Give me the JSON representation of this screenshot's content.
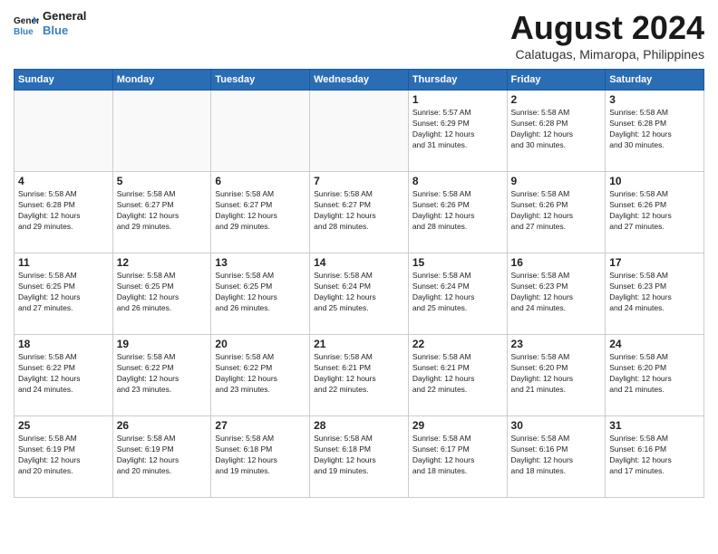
{
  "logo": {
    "line1": "General",
    "line2": "Blue"
  },
  "title": "August 2024",
  "location": "Calatugas, Mimaropa, Philippines",
  "days_of_week": [
    "Sunday",
    "Monday",
    "Tuesday",
    "Wednesday",
    "Thursday",
    "Friday",
    "Saturday"
  ],
  "weeks": [
    [
      {
        "day": "",
        "info": ""
      },
      {
        "day": "",
        "info": ""
      },
      {
        "day": "",
        "info": ""
      },
      {
        "day": "",
        "info": ""
      },
      {
        "day": "1",
        "info": "Sunrise: 5:57 AM\nSunset: 6:29 PM\nDaylight: 12 hours\nand 31 minutes."
      },
      {
        "day": "2",
        "info": "Sunrise: 5:58 AM\nSunset: 6:28 PM\nDaylight: 12 hours\nand 30 minutes."
      },
      {
        "day": "3",
        "info": "Sunrise: 5:58 AM\nSunset: 6:28 PM\nDaylight: 12 hours\nand 30 minutes."
      }
    ],
    [
      {
        "day": "4",
        "info": "Sunrise: 5:58 AM\nSunset: 6:28 PM\nDaylight: 12 hours\nand 29 minutes."
      },
      {
        "day": "5",
        "info": "Sunrise: 5:58 AM\nSunset: 6:27 PM\nDaylight: 12 hours\nand 29 minutes."
      },
      {
        "day": "6",
        "info": "Sunrise: 5:58 AM\nSunset: 6:27 PM\nDaylight: 12 hours\nand 29 minutes."
      },
      {
        "day": "7",
        "info": "Sunrise: 5:58 AM\nSunset: 6:27 PM\nDaylight: 12 hours\nand 28 minutes."
      },
      {
        "day": "8",
        "info": "Sunrise: 5:58 AM\nSunset: 6:26 PM\nDaylight: 12 hours\nand 28 minutes."
      },
      {
        "day": "9",
        "info": "Sunrise: 5:58 AM\nSunset: 6:26 PM\nDaylight: 12 hours\nand 27 minutes."
      },
      {
        "day": "10",
        "info": "Sunrise: 5:58 AM\nSunset: 6:26 PM\nDaylight: 12 hours\nand 27 minutes."
      }
    ],
    [
      {
        "day": "11",
        "info": "Sunrise: 5:58 AM\nSunset: 6:25 PM\nDaylight: 12 hours\nand 27 minutes."
      },
      {
        "day": "12",
        "info": "Sunrise: 5:58 AM\nSunset: 6:25 PM\nDaylight: 12 hours\nand 26 minutes."
      },
      {
        "day": "13",
        "info": "Sunrise: 5:58 AM\nSunset: 6:25 PM\nDaylight: 12 hours\nand 26 minutes."
      },
      {
        "day": "14",
        "info": "Sunrise: 5:58 AM\nSunset: 6:24 PM\nDaylight: 12 hours\nand 25 minutes."
      },
      {
        "day": "15",
        "info": "Sunrise: 5:58 AM\nSunset: 6:24 PM\nDaylight: 12 hours\nand 25 minutes."
      },
      {
        "day": "16",
        "info": "Sunrise: 5:58 AM\nSunset: 6:23 PM\nDaylight: 12 hours\nand 24 minutes."
      },
      {
        "day": "17",
        "info": "Sunrise: 5:58 AM\nSunset: 6:23 PM\nDaylight: 12 hours\nand 24 minutes."
      }
    ],
    [
      {
        "day": "18",
        "info": "Sunrise: 5:58 AM\nSunset: 6:22 PM\nDaylight: 12 hours\nand 24 minutes."
      },
      {
        "day": "19",
        "info": "Sunrise: 5:58 AM\nSunset: 6:22 PM\nDaylight: 12 hours\nand 23 minutes."
      },
      {
        "day": "20",
        "info": "Sunrise: 5:58 AM\nSunset: 6:22 PM\nDaylight: 12 hours\nand 23 minutes."
      },
      {
        "day": "21",
        "info": "Sunrise: 5:58 AM\nSunset: 6:21 PM\nDaylight: 12 hours\nand 22 minutes."
      },
      {
        "day": "22",
        "info": "Sunrise: 5:58 AM\nSunset: 6:21 PM\nDaylight: 12 hours\nand 22 minutes."
      },
      {
        "day": "23",
        "info": "Sunrise: 5:58 AM\nSunset: 6:20 PM\nDaylight: 12 hours\nand 21 minutes."
      },
      {
        "day": "24",
        "info": "Sunrise: 5:58 AM\nSunset: 6:20 PM\nDaylight: 12 hours\nand 21 minutes."
      }
    ],
    [
      {
        "day": "25",
        "info": "Sunrise: 5:58 AM\nSunset: 6:19 PM\nDaylight: 12 hours\nand 20 minutes."
      },
      {
        "day": "26",
        "info": "Sunrise: 5:58 AM\nSunset: 6:19 PM\nDaylight: 12 hours\nand 20 minutes."
      },
      {
        "day": "27",
        "info": "Sunrise: 5:58 AM\nSunset: 6:18 PM\nDaylight: 12 hours\nand 19 minutes."
      },
      {
        "day": "28",
        "info": "Sunrise: 5:58 AM\nSunset: 6:18 PM\nDaylight: 12 hours\nand 19 minutes."
      },
      {
        "day": "29",
        "info": "Sunrise: 5:58 AM\nSunset: 6:17 PM\nDaylight: 12 hours\nand 18 minutes."
      },
      {
        "day": "30",
        "info": "Sunrise: 5:58 AM\nSunset: 6:16 PM\nDaylight: 12 hours\nand 18 minutes."
      },
      {
        "day": "31",
        "info": "Sunrise: 5:58 AM\nSunset: 6:16 PM\nDaylight: 12 hours\nand 17 minutes."
      }
    ]
  ]
}
